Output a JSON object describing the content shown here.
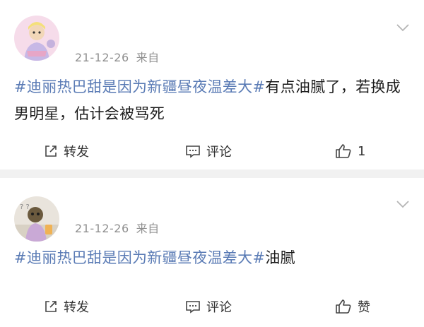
{
  "posts": [
    {
      "date": "21-12-26",
      "source": "来自",
      "tag": "#迪丽热巴甜是因为新疆昼夜温差大#",
      "body": "有点油腻了，若换成男明星，估计会被骂死",
      "share_label": "转发",
      "comment_label": "评论",
      "like_label": "1"
    },
    {
      "date": "21-12-26",
      "source": "来自",
      "tag": "#迪丽热巴甜是因为新疆昼夜温差大#",
      "body": "油腻",
      "share_label": "转发",
      "comment_label": "评论",
      "like_label": "赞"
    }
  ],
  "icons": {
    "share": "share-icon",
    "comment": "comment-icon",
    "like": "thumbs-up-icon",
    "menu": "chevron-down-icon"
  },
  "colors": {
    "background": "#f1f1f1",
    "card": "#ffffff",
    "hashtag": "#5a7bb5",
    "meta": "#8f8f8f"
  }
}
